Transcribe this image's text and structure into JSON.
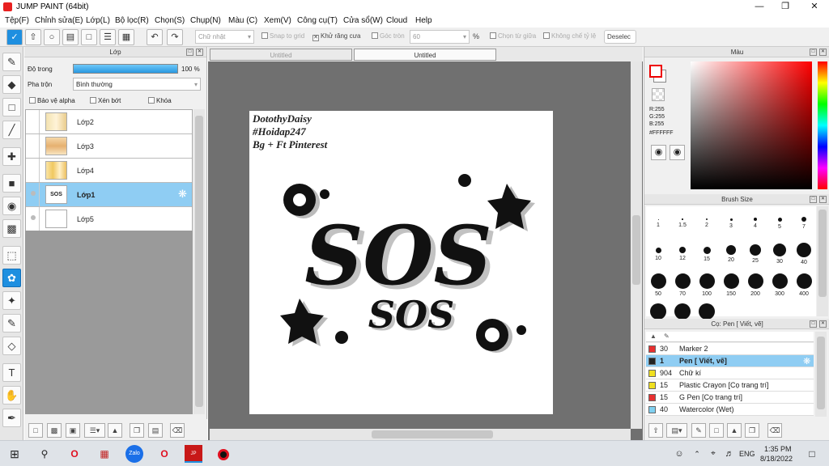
{
  "window": {
    "title": "JUMP PAINT (64bit)"
  },
  "menu": [
    "Tệp(F)",
    "Chỉnh sửa(E)",
    "Lớp(L)",
    "Bộ lọc(R)",
    "Chọn(S)",
    "Chụp(N)",
    "Màu (C)",
    "Xem(V)",
    "Công cụ(T)",
    "Cửa sổ(W)",
    "Cloud",
    "Help"
  ],
  "toolbar": {
    "shape_select": "Chữ nhật",
    "snap_grid": "Snap to grid",
    "antialias": "Khử răng cưa",
    "corner": "Góc tròn",
    "corner_value": "60",
    "percent": "%",
    "from_center": "Chọn từ giữa",
    "no_ratio": "Không chế tỷ lệ",
    "deselect": "Deselec"
  },
  "layers": {
    "title": "Lớp",
    "opacity_label": "Độ trong",
    "opacity_value": "100 %",
    "opacity": 1.0,
    "blend_label": "Pha trộn",
    "blend_value": "Bình thường",
    "protect_alpha": "Bảo vệ alpha",
    "clipping": "Xén bớt",
    "lock": "Khóa",
    "items": [
      {
        "name": "Lớp2"
      },
      {
        "name": "Lớp3"
      },
      {
        "name": "Lớp4"
      },
      {
        "name": "Lớp1",
        "selected": true
      },
      {
        "name": "Lớp5"
      }
    ]
  },
  "tabs": [
    "Untitled",
    "Untitled"
  ],
  "artwork": {
    "credit1": "DotothyDaisy",
    "credit2": "#Hoidap247",
    "credit3": "Bg + Ft Pinterest",
    "big_text": "SOS",
    "small_text": "SOS"
  },
  "color": {
    "title": "Màu",
    "r": "R:255",
    "g": "G:255",
    "b": "B:255",
    "hex": "#FFFFFF",
    "fg": "#ffffff",
    "accent": "#ff0000"
  },
  "brush_size": {
    "title": "Brush Size",
    "sizes": [
      "1",
      "1.5",
      "2",
      "3",
      "4",
      "5",
      "7",
      "10",
      "12",
      "15",
      "20",
      "25",
      "30",
      "40",
      "50",
      "70",
      "100",
      "150",
      "200",
      "300",
      "400",
      "",
      "",
      ""
    ]
  },
  "brushes": {
    "title": "Cọ: Pen [ Viết, vẽ]",
    "items": [
      {
        "num": "30",
        "name": "Marker 2",
        "color": "#e83030"
      },
      {
        "num": "1",
        "name": "Pen [ Viết, vẽ]",
        "color": "#222222",
        "selected": true
      },
      {
        "num": "904",
        "name": "Chữ kí",
        "color": "#f0e020"
      },
      {
        "num": "15",
        "name": "Plastic Crayon [Cọ trang trí]",
        "color": "#f0e020"
      },
      {
        "num": "15",
        "name": "G Pen [Cọ trang trí]",
        "color": "#e83030"
      },
      {
        "num": "40",
        "name": "Watercolor (Wet)",
        "color": "#80d0f0"
      }
    ]
  },
  "taskbar": {
    "time": "1:35 PM",
    "date": "8/18/2022",
    "lang": "ENG"
  }
}
